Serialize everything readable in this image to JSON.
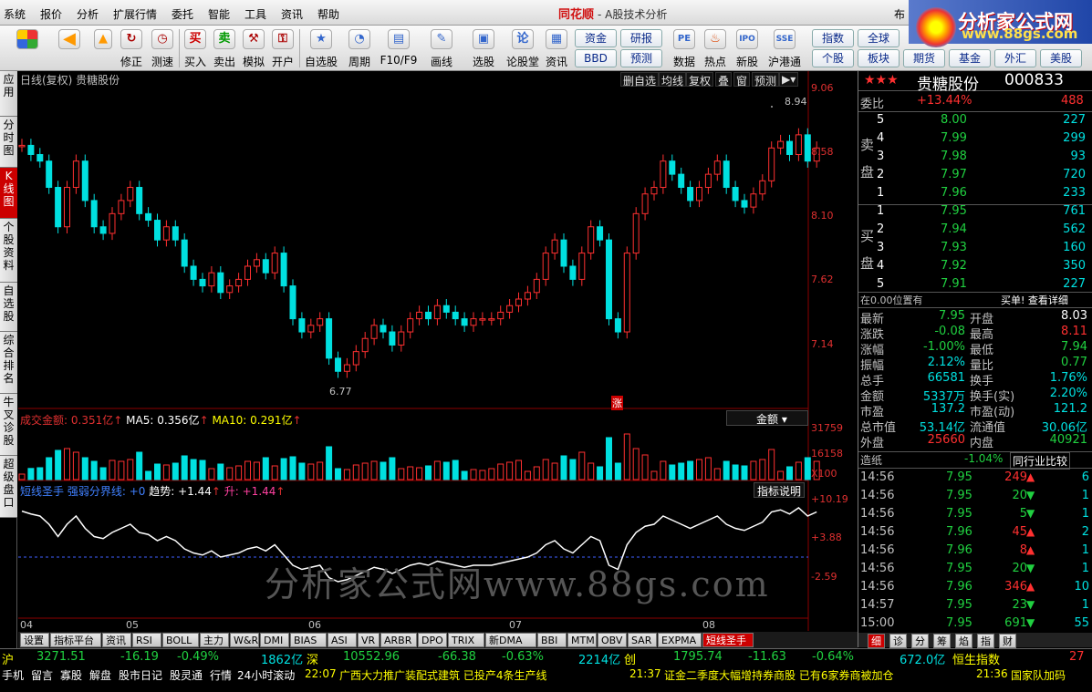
{
  "menu": [
    "系统",
    "报价",
    "分析",
    "扩展行情",
    "委托",
    "智能",
    "工具",
    "资讯",
    "帮助"
  ],
  "brand": {
    "name": "同花顺",
    "subtitle": "- A股技术分析"
  },
  "toolbar": {
    "main": [
      "修正",
      "测速",
      "买入",
      "卖出",
      "模拟",
      "开户",
      "自选股",
      "周期",
      "F10/F9",
      "画线",
      "选股",
      "论股堂",
      "资讯",
      "数据",
      "热点",
      "新股",
      "沪港通"
    ],
    "btns_left": [
      "资金",
      "研报",
      "BBD",
      "预测"
    ],
    "btns_right": [
      "指数",
      "全球",
      "个股",
      "板块",
      "期货",
      "基金",
      "外汇",
      "美股"
    ],
    "overflow": "布"
  },
  "logo88": {
    "line1": "分析家公式网",
    "line2": "www.88gs.com"
  },
  "leftbar": [
    "应用",
    "分时图",
    "K线图",
    "个股资料",
    "自选股",
    "综合排名",
    "牛叉诊股",
    "超级盘口"
  ],
  "chart": {
    "title": "日线(复权) 贵糖股份",
    "buttons": [
      "删自选",
      "均线",
      "复权",
      "叠",
      "窗",
      "预测"
    ],
    "price_axis": [
      "9.06",
      "8.58",
      "8.10",
      "7.62",
      "7.14"
    ],
    "high_label": "8.94",
    "low_label": "6.77",
    "zhang": "涨",
    "vol_legend": {
      "name": "成交金额:",
      "name_val": "0.351亿",
      "ma5": "MA5:",
      "ma5_val": "0.356亿",
      "ma10": "MA10:",
      "ma10_val": "0.291亿"
    },
    "vol_select": "金额",
    "vol_axis": [
      "31759",
      "16158",
      "X100"
    ],
    "ind_legend": {
      "name": "短线圣手",
      "sub": "强弱分界线: +0",
      "trend": "趋势: +1.44",
      "rise": "升: +1.44"
    },
    "ind_btn": "指标说明",
    "ind_axis": [
      "+10.19",
      "+3.88",
      "-2.59"
    ],
    "x_axis": [
      "04",
      "05",
      "06",
      "07",
      "08"
    ],
    "watermark": "分析家公式网www.88gs.com"
  },
  "btm_tabs": [
    "设置",
    "指标平台",
    "资讯",
    "RSI",
    "BOLL",
    "主力",
    "W&R",
    "DMI",
    "BIAS",
    "ASI",
    "VR",
    "ARBR",
    "DPO",
    "TRIX",
    "新DMA",
    "BBI",
    "MTM",
    "OBV",
    "SAR",
    "EXPMA",
    "短线圣手"
  ],
  "right": {
    "title": "贵糖股份",
    "code": "000833",
    "weibi_label": "委比",
    "weibi": "+13.44%",
    "weibi_diff": "488",
    "sell_label": "卖盘",
    "buy_label": "买盘",
    "asks": [
      {
        "lv": "5",
        "p": "8.00",
        "v": "227"
      },
      {
        "lv": "4",
        "p": "7.99",
        "v": "299"
      },
      {
        "lv": "3",
        "p": "7.98",
        "v": "93"
      },
      {
        "lv": "2",
        "p": "7.97",
        "v": "720"
      },
      {
        "lv": "1",
        "p": "7.96",
        "v": "233"
      }
    ],
    "bids": [
      {
        "lv": "1",
        "p": "7.95",
        "v": "761"
      },
      {
        "lv": "2",
        "p": "7.94",
        "v": "562"
      },
      {
        "lv": "3",
        "p": "7.93",
        "v": "160"
      },
      {
        "lv": "4",
        "p": "7.92",
        "v": "350"
      },
      {
        "lv": "5",
        "p": "7.91",
        "v": "227"
      }
    ],
    "pos": "在0.00位置有",
    "pos_r": "买单! 查看详细",
    "stats": [
      [
        "最新",
        "7.95",
        "开盘",
        "8.03"
      ],
      [
        "涨跌",
        "-0.08",
        "最高",
        "8.11"
      ],
      [
        "涨幅",
        "-1.00%",
        "最低",
        "7.94"
      ],
      [
        "振幅",
        "2.12%",
        "量比",
        "0.77"
      ],
      [
        "总手",
        "66581",
        "换手",
        "1.76%"
      ],
      [
        "金额",
        "5337万",
        "换手(实)",
        "2.20%"
      ],
      [
        "市盈",
        "137.2",
        "市盈(动)",
        "121.2"
      ],
      [
        "总市值",
        "53.14亿",
        "流通值",
        "30.06亿"
      ],
      [
        "外盘",
        "25660",
        "内盘",
        "40921"
      ]
    ],
    "industry": "造纸",
    "industry_chg": "-1.04%",
    "industry_btn": "同行业比较",
    "ticks": [
      [
        "14:56",
        "7.95",
        "249",
        "6"
      ],
      [
        "14:56",
        "7.95",
        "20",
        "1"
      ],
      [
        "14:56",
        "7.95",
        "5",
        "1"
      ],
      [
        "14:56",
        "7.96",
        "45",
        "2"
      ],
      [
        "14:56",
        "7.96",
        "8",
        "1"
      ],
      [
        "14:56",
        "7.95",
        "20",
        "1"
      ],
      [
        "14:56",
        "7.96",
        "346",
        "10"
      ],
      [
        "14:57",
        "7.95",
        "23",
        "1"
      ],
      [
        "15:00",
        "7.95",
        "691",
        "55"
      ]
    ],
    "rtabs": [
      "细",
      "诊",
      "分",
      "筹",
      "焰",
      "指",
      "财"
    ]
  },
  "status": {
    "sh": "沪",
    "sh_val": "3271.51",
    "sh_chg": "-16.19",
    "sh_pct": "-0.49%",
    "sh_amt": "1862亿",
    "sz": "深",
    "sz_val": "10552.96",
    "sz_chg": "-66.38",
    "sz_pct": "-0.63%",
    "sz_amt": "2214亿",
    "cy": "创",
    "cy_val": "1795.74",
    "cy_chg": "-11.63",
    "cy_pct": "-0.64%",
    "cy_amt": "672.0亿",
    "hs": "恒生指数",
    "hs_val": "27"
  },
  "news": {
    "btns": [
      "手机",
      "留言",
      "寡股",
      "解盘",
      "股市日记",
      "股灵通",
      "行情",
      "24小时滚动"
    ],
    "n1t": "22:07",
    "n1": "广西大力推广装配式建筑 已投产4条生产线",
    "n2t": "21:37",
    "n2": "证金二季度大幅增持券商股 已有6家券商被加仓",
    "n3t": "21:36",
    "n3": "国家队加码"
  }
}
